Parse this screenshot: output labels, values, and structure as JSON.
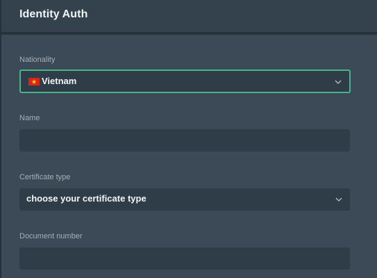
{
  "header": {
    "title": "Identity Auth"
  },
  "form": {
    "nationality": {
      "label": "Nationality",
      "value": "Vietnam"
    },
    "name": {
      "label": "Name",
      "value": ""
    },
    "certificate_type": {
      "label": "Certificate type",
      "placeholder": "choose your certificate type"
    },
    "document_number": {
      "label": "Document number",
      "value": ""
    }
  },
  "colors": {
    "background": "#3b4a56",
    "header": "#34424e",
    "field": "#2f3d48",
    "focus_border": "#49b48b",
    "flag_red": "#da251d",
    "flag_star": "#ffde00"
  }
}
